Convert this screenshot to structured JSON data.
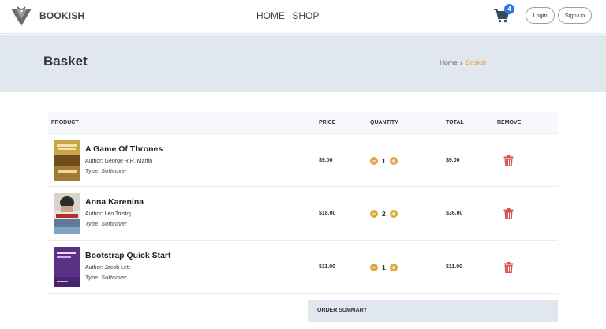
{
  "nav": {
    "brand": "BOOKISH",
    "links": [
      "HOME",
      "SHOP"
    ],
    "cart_count": "4",
    "login_label": "Login",
    "signup_label": "Sign up"
  },
  "header": {
    "title": "Basket",
    "breadcrumb_home": "Home",
    "breadcrumb_sep": "/",
    "breadcrumb_current": "Basket"
  },
  "table": {
    "columns": {
      "product": "PRODUCT",
      "price": "PRICE",
      "quantity": "QUANTITY",
      "total": "TOTAL",
      "remove": "REMOVE"
    },
    "rows": [
      {
        "title": "A Game Of Thrones",
        "author": "Author: George R.R. Martin",
        "type": "Type: Softcover",
        "price": "$9.00",
        "quantity": "1",
        "total": "$9.00"
      },
      {
        "title": "Anna Karenina",
        "author": "Author: Leo Tolstoj",
        "type": "Type: Softcover",
        "price": "$18.00",
        "quantity": "2",
        "total": "$36.00"
      },
      {
        "title": "Bootstrap Quick Start",
        "author": "Author: Jacob Lett",
        "type": "Type: Softcover",
        "price": "$11.00",
        "quantity": "1",
        "total": "$11.00"
      }
    ]
  },
  "summary": {
    "title": "ORDER SUMMARY"
  },
  "colors": {
    "accent": "#e2a545",
    "header_band": "#e1e7ef",
    "badge": "#2a76e4",
    "trash": "#d9534f"
  },
  "icons": {
    "cart": "cart-icon",
    "minus": "minus-circle-icon",
    "plus": "plus-circle-icon",
    "remove": "trash-icon"
  }
}
